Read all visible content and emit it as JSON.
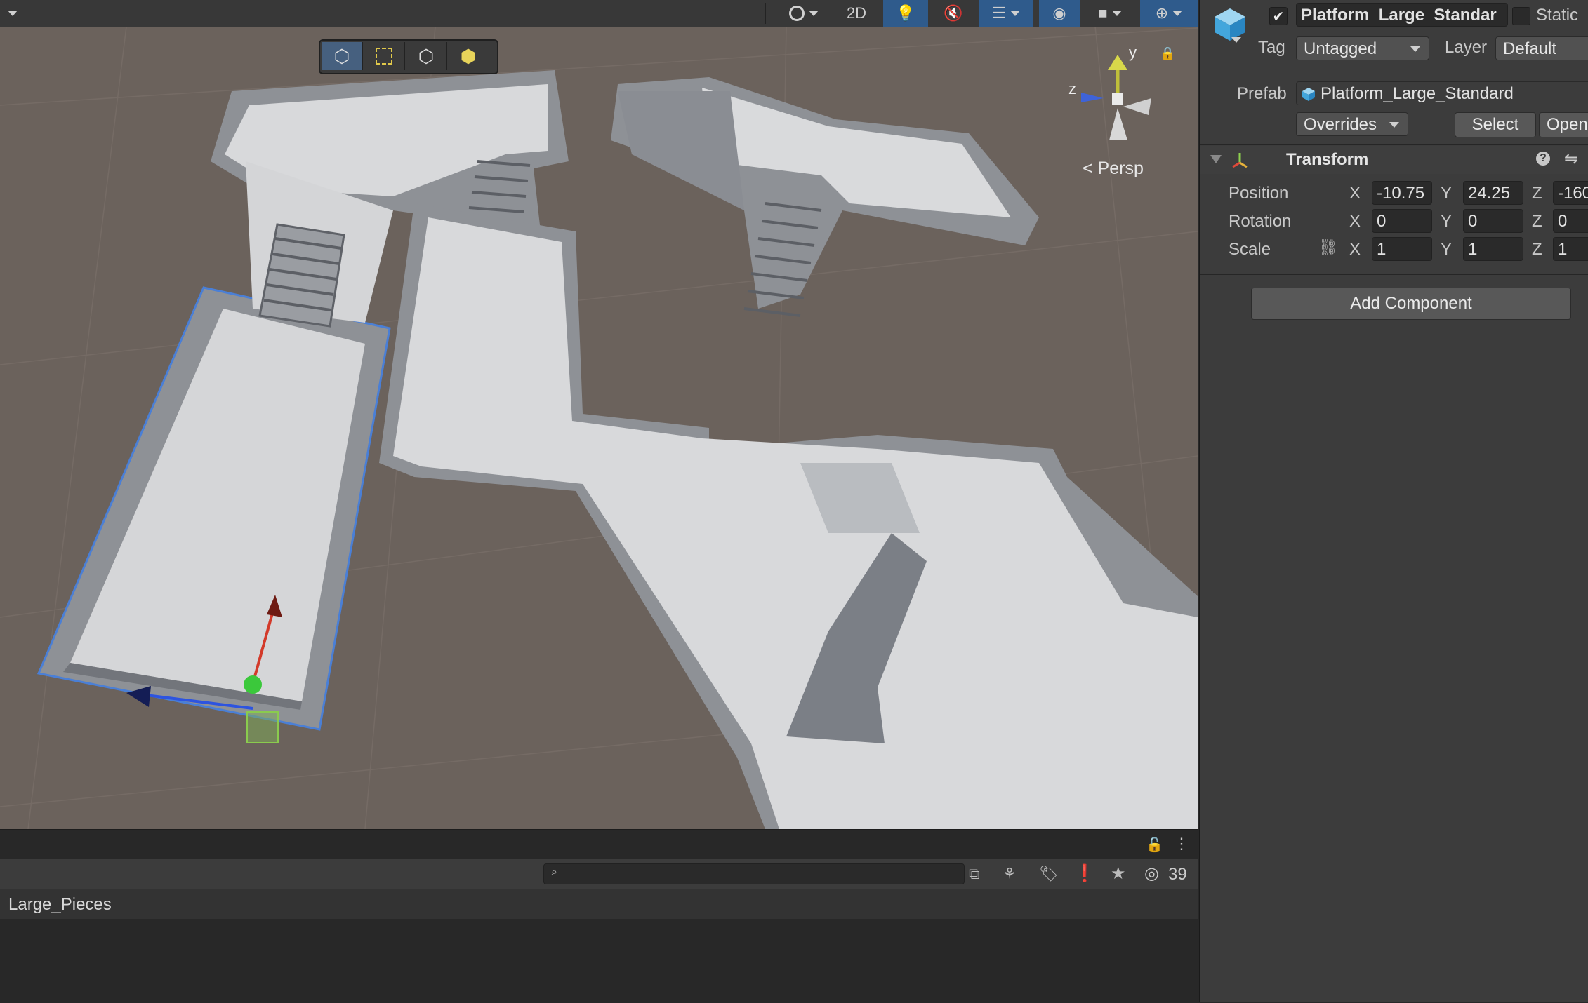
{
  "scene": {
    "toolbar": {
      "mode_2d": "2D",
      "hidden_count": "39"
    },
    "persp_label": "< Persp",
    "gizmo_axes": {
      "y": "y",
      "z": "z"
    }
  },
  "inspector": {
    "object_name": "Platform_Large_Standar",
    "static_label": "Static",
    "tag_label": "Tag",
    "tag_value": "Untagged",
    "layer_label": "Layer",
    "layer_value": "Default",
    "prefab_label": "Prefab",
    "prefab_value": "Platform_Large_Standard",
    "overrides_label": "Overrides",
    "select_label": "Select",
    "open_label": "Open",
    "transform": {
      "title": "Transform",
      "position_label": "Position",
      "rotation_label": "Rotation",
      "scale_label": "Scale",
      "position": {
        "x": "-10.75",
        "y": "24.25",
        "z": "-160"
      },
      "rotation": {
        "x": "0",
        "y": "0",
        "z": "0"
      },
      "scale": {
        "x": "1",
        "y": "1",
        "z": "1"
      },
      "axis_x": "X",
      "axis_y": "Y",
      "axis_z": "Z"
    },
    "add_component_label": "Add Component"
  },
  "project": {
    "search_value": "",
    "breadcrumb": "Large_Pieces"
  },
  "colors": {
    "accent": "#2f5b8c",
    "scene_ground": "#6b625c",
    "floor": "#d6d7d9",
    "wall": "#8c8f95"
  }
}
